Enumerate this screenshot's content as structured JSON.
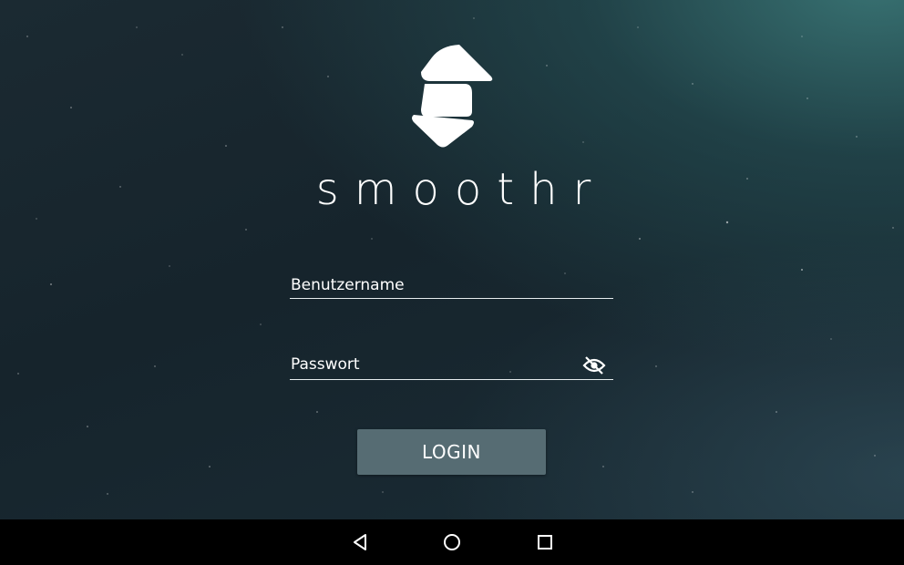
{
  "app": {
    "brand_name": "smoothr",
    "logo_icon": "smoothr-logo-icon"
  },
  "form": {
    "username": {
      "placeholder": "Benutzername",
      "value": ""
    },
    "password": {
      "placeholder": "Passwort",
      "value": "",
      "toggle_icon": "eye-off-icon"
    },
    "login_label": "LOGIN"
  },
  "navigation_bar": {
    "back_icon": "back-triangle-icon",
    "home_icon": "home-circle-icon",
    "recents_icon": "recents-square-icon"
  },
  "colors": {
    "background_dark": "#16242c",
    "background_teal": "#3a7676",
    "button_background": "#566c73",
    "text": "#ffffff",
    "nav_bar": "#000000"
  }
}
